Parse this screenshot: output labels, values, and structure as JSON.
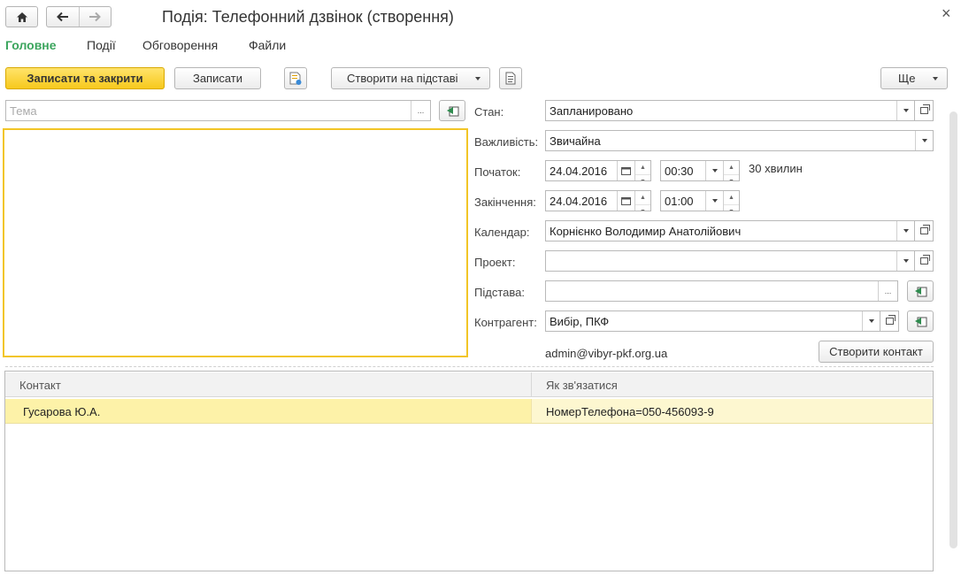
{
  "window": {
    "title": "Подія: Телефонний дзвінок (створення)",
    "close_glyph": "×"
  },
  "tabs": [
    {
      "label": "Головне",
      "active": true
    },
    {
      "label": "Події"
    },
    {
      "label": "Обговорення"
    },
    {
      "label": "Файли"
    }
  ],
  "toolbar": {
    "save_close_label": "Записати та закрити",
    "save_label": "Записати",
    "create_based_label": "Створити на підставі",
    "more_label": "Ще"
  },
  "subject": {
    "placeholder": "Тема",
    "select_glyph": "..."
  },
  "form": {
    "state_label": "Стан:",
    "state_value": "Запланировано",
    "importance_label": "Важливість:",
    "importance_value": "Звичайна",
    "start_label": "Початок:",
    "start_date": "24.04.2016",
    "start_time": "00:30",
    "duration": "30 хвилин",
    "end_label": "Закінчення:",
    "end_date": "24.04.2016",
    "end_time": "01:00",
    "calendar_label": "Календар:",
    "calendar_value": "Корнієнко Володимир Анатолійович",
    "project_label": "Проект:",
    "project_value": "",
    "basis_label": "Підстава:",
    "basis_value": "",
    "counterparty_label": "Контрагент:",
    "counterparty_value": "Вибір, ПКФ",
    "email": "admin@vibyr-pkf.org.ua",
    "create_contact_label": "Створити контакт",
    "select_glyph": "..."
  },
  "contacts": {
    "columns": [
      "Контакт",
      "Як зв'язатися"
    ],
    "rows": [
      {
        "contact": "Гусарова Ю.А.",
        "how": "НомерТелефона=050-456093-9"
      }
    ]
  },
  "colors": {
    "accent_green": "#3ba55d",
    "primary_yellow": "#f7c91c",
    "selected_row": "#fdf2a8",
    "focus_border": "#f2c526"
  }
}
